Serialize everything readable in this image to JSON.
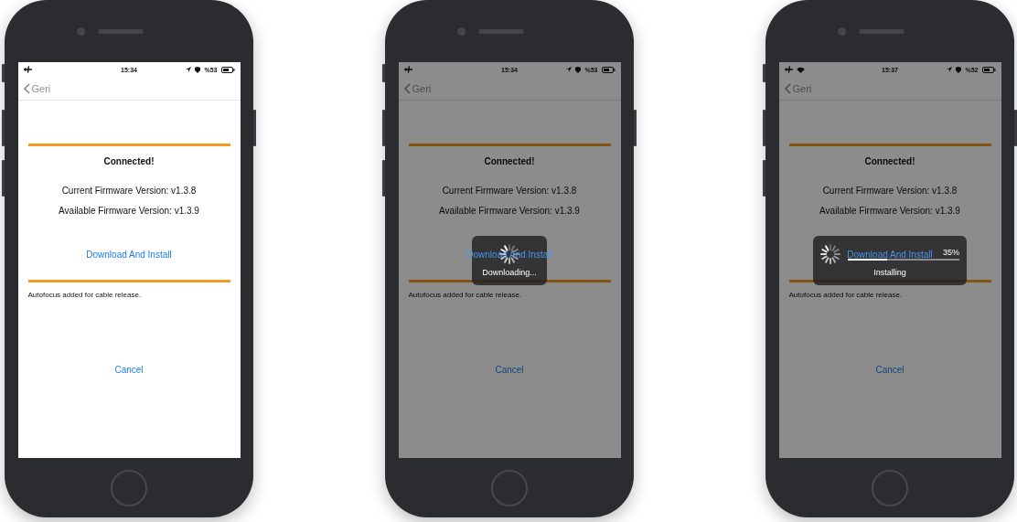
{
  "phones": [
    {
      "status_bar": {
        "time": "15:34",
        "battery": "%53",
        "wifi": false
      },
      "back": "Geri",
      "title": "Connected!",
      "current_version": "Current Firmware Version: v1.3.8",
      "available_version": "Available Firmware Version: v1.3.9",
      "action": "Download And Install",
      "notes": "Autofocus added for cable release.",
      "cancel": "Cancel",
      "dimmed": false,
      "hud": {
        "kind": "none"
      }
    },
    {
      "status_bar": {
        "time": "15:34",
        "battery": "%53",
        "wifi": false
      },
      "back": "Geri",
      "title": "Connected!",
      "current_version": "Current Firmware Version: v1.3.8",
      "available_version": "Available Firmware Version: v1.3.9",
      "action": "Download And Install",
      "notes": "Autofocus added for cable release.",
      "cancel": "Cancel",
      "dimmed": true,
      "hud": {
        "kind": "spinner",
        "text": "Downloading..."
      }
    },
    {
      "status_bar": {
        "time": "15:37",
        "battery": "%52",
        "wifi": true
      },
      "back": "Geri",
      "title": "Connected!",
      "current_version": "Current Firmware Version: v1.3.8",
      "available_version": "Available Firmware Version: v1.3.9",
      "action": "Download And Install",
      "notes": "Autofocus added for cable release.",
      "cancel": "Cancel",
      "dimmed": true,
      "hud": {
        "kind": "progress",
        "text": "Installing",
        "percent": "35%",
        "level": 0.35
      }
    }
  ]
}
